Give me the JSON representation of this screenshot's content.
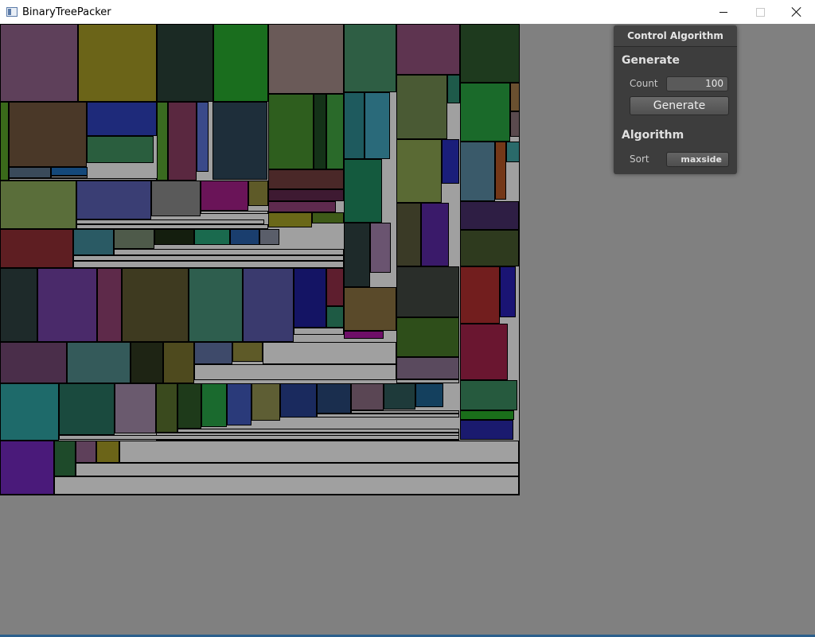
{
  "window": {
    "title": "BinaryTreePacker",
    "minimize_icon": "minimize-icon",
    "maximize_icon": "maximize-icon",
    "close_icon": "close-icon"
  },
  "colors": {
    "client_background": "#808080",
    "packing_background": "#a0a0a0",
    "panel_background": "#3d3d3d"
  },
  "panel": {
    "title": "Control Algorithm",
    "generate_section": "Generate",
    "count_label": "Count",
    "count_value": "100",
    "generate_button": "Generate",
    "algorithm_section": "Algorithm",
    "sort_label": "Sort",
    "sort_value": "maxside",
    "sort_chevron": "›"
  },
  "packing": {
    "rect_colors": [
      "#5e405a",
      "#6b6418",
      "#1b2a24",
      "#1a6e1e",
      "#6a5a58",
      "#2e5e44",
      "#5e3450",
      "#1e3a1e",
      "#3a6a1a",
      "#4a3828",
      "#1e2a7a",
      "#2a5e3e",
      "#3a6a20",
      "#5a2840",
      "#3a4a8a",
      "#1e2e3a",
      "#2e5e1e",
      "#143218",
      "#2a6a2a",
      "#1e5a5e",
      "#2a6a7a",
      "#4a5a34",
      "#1e5a4a",
      "#1a6a2a",
      "#6a5030",
      "#5a4a4e",
      "#3a5a6a",
      "#743818",
      "#2a6a6a",
      "#3a4a5a",
      "#14487a",
      "#5a6e3a",
      "#3a3e74",
      "#5a5a5a",
      "#6a1458",
      "#5e5a28",
      "#4a2828",
      "#3e1a32",
      "#5e2a4e",
      "#6a6818",
      "#3e5a18",
      "#145a3e",
      "#5a6a34",
      "#1a1e7a",
      "#5e1e22",
      "#2a5a64",
      "#4e5a4a",
      "#141e0e",
      "#1a6a4e",
      "#1a3e6e",
      "#5a5e6a",
      "#1e2a2a",
      "#6a5470",
      "#3a3a26",
      "#3a1a6a",
      "#2e1e44",
      "#2e3a1e",
      "#1e2a2a",
      "#4a2a6a",
      "#5e2a4a",
      "#3e3a20",
      "#2e5e4e",
      "#3a3a6e",
      "#141464",
      "#5e1e2e",
      "#1e5a44",
      "#5a4a2a",
      "#2a2e2a",
      "#721e1e",
      "#1a1474",
      "#4a2e4a",
      "#345a5a",
      "#1e2414",
      "#4e4a1e",
      "#3e4a6a",
      "#5e5a28",
      "#6e0e68",
      "#2e4e1a",
      "#5a4a5e",
      "#6a1630",
      "#265a3e",
      "#1a6e1a",
      "#1e6a6a",
      "#1a4a3e",
      "#6a5a6e",
      "#3a4a1e",
      "#1e3a1a",
      "#1a6a2e",
      "#2a3a7a",
      "#5e5e34",
      "#1a2a5e",
      "#1a2e4e",
      "#5a4654",
      "#1e3a3a",
      "#14405e",
      "#1a1a6e",
      "#4a1a7a",
      "#1e4a2a"
    ]
  }
}
